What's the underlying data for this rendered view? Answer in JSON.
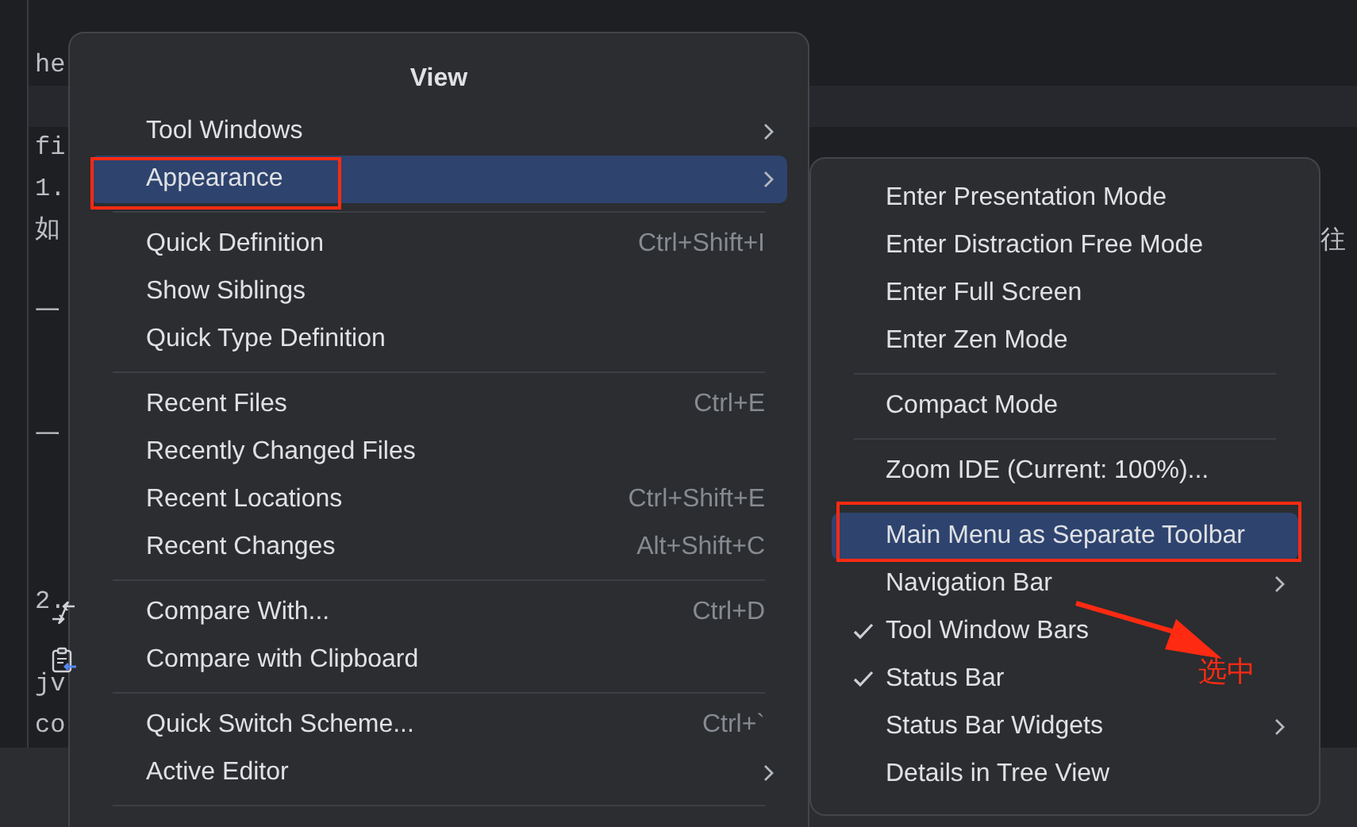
{
  "editor": {
    "lines": [
      {
        "text": "he",
        "band": false
      },
      {
        "band": true
      },
      {
        "text": "fi",
        "band": false
      },
      {
        "text": "1.",
        "band": false
      },
      {
        "text": "如",
        "band": false
      },
      {
        "band": false
      },
      {
        "text": "一",
        "band": false
      },
      {
        "band": false
      },
      {
        "band": false
      },
      {
        "text": "一",
        "band": false
      },
      {
        "band": false
      },
      {
        "band": false
      },
      {
        "band": false
      },
      {
        "text": "2.",
        "band": false
      },
      {
        "band": false
      },
      {
        "text": "jv",
        "band": false
      },
      {
        "text": "co",
        "band": false
      }
    ],
    "right_fragment": "往"
  },
  "view_menu": {
    "title": "View",
    "sections": [
      [
        {
          "label": "Tool Windows",
          "submenu": true,
          "selected": false,
          "kind": "plain"
        },
        {
          "label": "Appearance",
          "submenu": true,
          "selected": true,
          "kind": "plain"
        }
      ],
      [
        {
          "label": "Quick Definition",
          "shortcut": "Ctrl+Shift+I",
          "submenu": false,
          "selected": false,
          "kind": "plain"
        },
        {
          "label": "Show Siblings",
          "submenu": false,
          "selected": false,
          "kind": "plain"
        },
        {
          "label": "Quick Type Definition",
          "submenu": false,
          "selected": false,
          "kind": "plain"
        }
      ],
      [
        {
          "label": "Recent Files",
          "shortcut": "Ctrl+E",
          "submenu": false,
          "selected": false,
          "kind": "plain"
        },
        {
          "label": "Recently Changed Files",
          "submenu": false,
          "selected": false,
          "kind": "plain"
        },
        {
          "label": "Recent Locations",
          "shortcut": "Ctrl+Shift+E",
          "submenu": false,
          "selected": false,
          "kind": "plain"
        },
        {
          "label": "Recent Changes",
          "shortcut": "Alt+Shift+C",
          "submenu": false,
          "selected": false,
          "kind": "plain"
        }
      ],
      [
        {
          "label": "Compare With...",
          "shortcut": "Ctrl+D",
          "submenu": false,
          "selected": false,
          "kind": "compare"
        },
        {
          "label": "Compare with Clipboard",
          "submenu": false,
          "selected": false,
          "kind": "clipboard"
        }
      ],
      [
        {
          "label": "Quick Switch Scheme...",
          "shortcut": "Ctrl+`",
          "submenu": false,
          "selected": false,
          "kind": "plain"
        },
        {
          "label": "Active Editor",
          "submenu": true,
          "selected": false,
          "kind": "plain"
        }
      ]
    ]
  },
  "appearance_menu": {
    "sections": [
      [
        {
          "label": "Enter Presentation Mode",
          "checked": false,
          "submenu": false,
          "selected": false
        },
        {
          "label": "Enter Distraction Free Mode",
          "checked": false,
          "submenu": false,
          "selected": false
        },
        {
          "label": "Enter Full Screen",
          "checked": false,
          "submenu": false,
          "selected": false
        },
        {
          "label": "Enter Zen Mode",
          "checked": false,
          "submenu": false,
          "selected": false
        }
      ],
      [
        {
          "label": "Compact Mode",
          "checked": false,
          "submenu": false,
          "selected": false
        }
      ],
      [
        {
          "label": "Zoom IDE (Current: 100%)...",
          "checked": false,
          "submenu": false,
          "selected": false
        }
      ],
      [
        {
          "label": "Main Menu as Separate Toolbar",
          "checked": false,
          "submenu": false,
          "selected": true
        },
        {
          "label": "Navigation Bar",
          "checked": false,
          "submenu": true,
          "selected": false
        },
        {
          "label": "Tool Window Bars",
          "checked": true,
          "submenu": false,
          "selected": false
        },
        {
          "label": "Status Bar",
          "checked": true,
          "submenu": false,
          "selected": false
        },
        {
          "label": "Status Bar Widgets",
          "checked": false,
          "submenu": true,
          "selected": false
        },
        {
          "label": "Details in Tree View",
          "checked": false,
          "submenu": false,
          "selected": false
        }
      ]
    ]
  },
  "annotation": {
    "label": "选中"
  }
}
